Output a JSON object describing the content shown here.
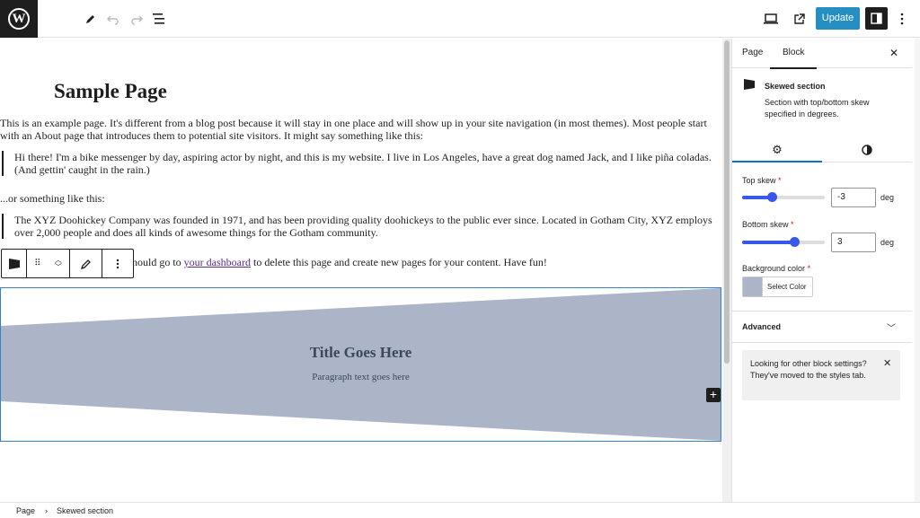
{
  "topbar": {
    "wp_logo_text": "W",
    "update_label": "Update",
    "icons": [
      "add-block-icon",
      "tools-pen-icon",
      "undo-icon",
      "redo-icon",
      "list-view-icon",
      "preview-desktop-icon",
      "external-view-icon",
      "settings-panel-icon",
      "more-vertical-icon"
    ]
  },
  "content": {
    "title": "Sample Page",
    "p1": "This is an example page. It's different from a blog post because it will stay in one place and will show up in your site navigation (in most themes). Most people start with an About page that introduces them to potential site visitors. It might say something like this:",
    "quote1": "Hi there! I'm a bike messenger by day, aspiring actor by night, and this is my website. I live in Los Angeles, have a great dog named Jack, and I like piña coladas. (And gettin' caught in the rain.)",
    "p2": "...or something like this:",
    "quote2": "The XYZ Doohickey Company was founded in 1971, and has been providing quality doohickeys to the public ever since. Located in Gotham City, XYZ employs over 2,000 people and does all kinds of awesome things for the Gotham community.",
    "p3_before": "hould go to ",
    "p3_link": "your dashboard",
    "p3_after": " to delete this page and create new pages for your content. Have fun!",
    "skew": {
      "title": "Title Goes Here",
      "paragraph": "Paragraph text goes here",
      "fill_color": "#abb5c7"
    }
  },
  "sidebar": {
    "tabs": [
      "Page",
      "Block"
    ],
    "active_tab": "Block",
    "block_name": "Skewed section",
    "block_desc": "Section with top/bottom skew specified in degrees.",
    "top_skew": {
      "label": "Top skew",
      "required": "*",
      "value": "-3",
      "unit": "deg",
      "slider_fraction": 0.36
    },
    "bottom_skew": {
      "label": "Bottom skew",
      "required": "*",
      "value": "3",
      "unit": "deg",
      "slider_fraction": 0.63
    },
    "background": {
      "label": "Background color",
      "required": "*",
      "button": "Select Color",
      "swatch": "#abb5c7"
    },
    "advanced_label": "Advanced",
    "notice": "Looking for other block settings? They've moved to the styles tab."
  },
  "footer": {
    "crumb_root": "Page",
    "crumb_sep": "›",
    "crumb_current": "Skewed section"
  }
}
